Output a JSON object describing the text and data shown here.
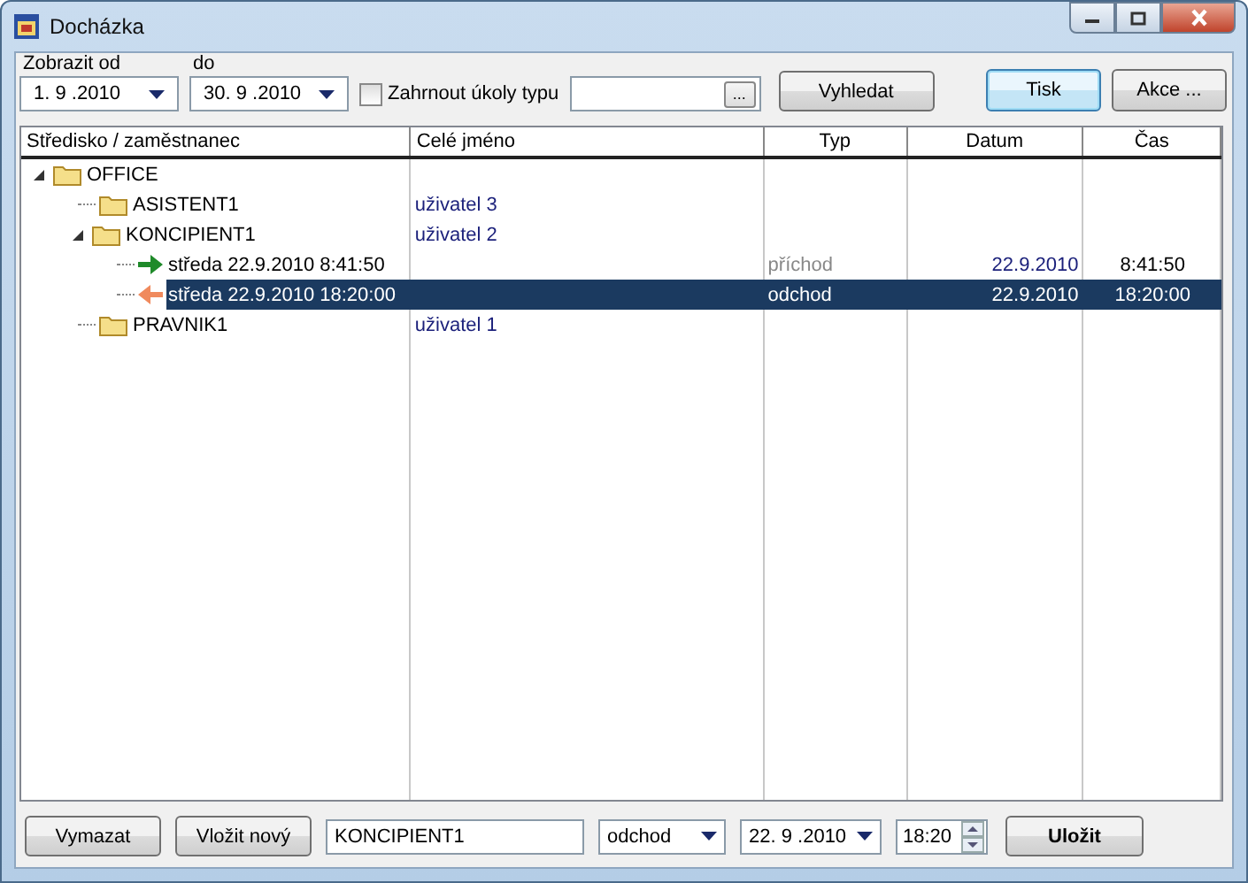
{
  "window": {
    "title": "Docházka"
  },
  "filter": {
    "from_label": "Zobrazit od",
    "from_value": "1. 9 .2010",
    "to_label": "do",
    "to_value": "30. 9 .2010",
    "include_label": "Zahrnout úkoly typu",
    "include_checked": false,
    "browse_label": "...",
    "search_button": "Vyhledat"
  },
  "actions": [
    {
      "label": "Tisk",
      "focused": true
    },
    {
      "label": "Akce ...",
      "focused": false
    }
  ],
  "table": {
    "columns": [
      "Středisko / zaměstnanec",
      "Celé jméno",
      "Typ",
      "Datum",
      "Čas"
    ],
    "rows": [
      {
        "kind": "folder",
        "label": "OFFICE",
        "expanded": true,
        "children": [
          {
            "kind": "folder",
            "label": "ASISTENT1",
            "full_name": "uživatel 3"
          },
          {
            "kind": "folder",
            "label": "KONCIPIENT1",
            "full_name": "uživatel 2",
            "expanded": true,
            "children": [
              {
                "kind": "arrival",
                "label": "středa 22.9.2010 8:41:50",
                "type": "příchod",
                "dimmed": true,
                "date": "22.9.2010",
                "time": "8:41:50",
                "selected": false
              },
              {
                "kind": "departure",
                "label": "středa 22.9.2010 18:20:00",
                "type": "odchod",
                "dimmed": false,
                "date": "22.9.2010",
                "time": "18:20:00",
                "selected": true
              }
            ]
          },
          {
            "kind": "folder",
            "label": "PRAVNIK1",
            "full_name": "uživatel 1"
          }
        ]
      }
    ]
  },
  "editor": {
    "delete_button": "Vymazat",
    "new_button": "Vložit nový",
    "name_value": "KONCIPIENT1",
    "type_value": "odchod",
    "date_value": "22. 9 .2010",
    "time_value": "18:20",
    "save_button": "Uložit"
  }
}
